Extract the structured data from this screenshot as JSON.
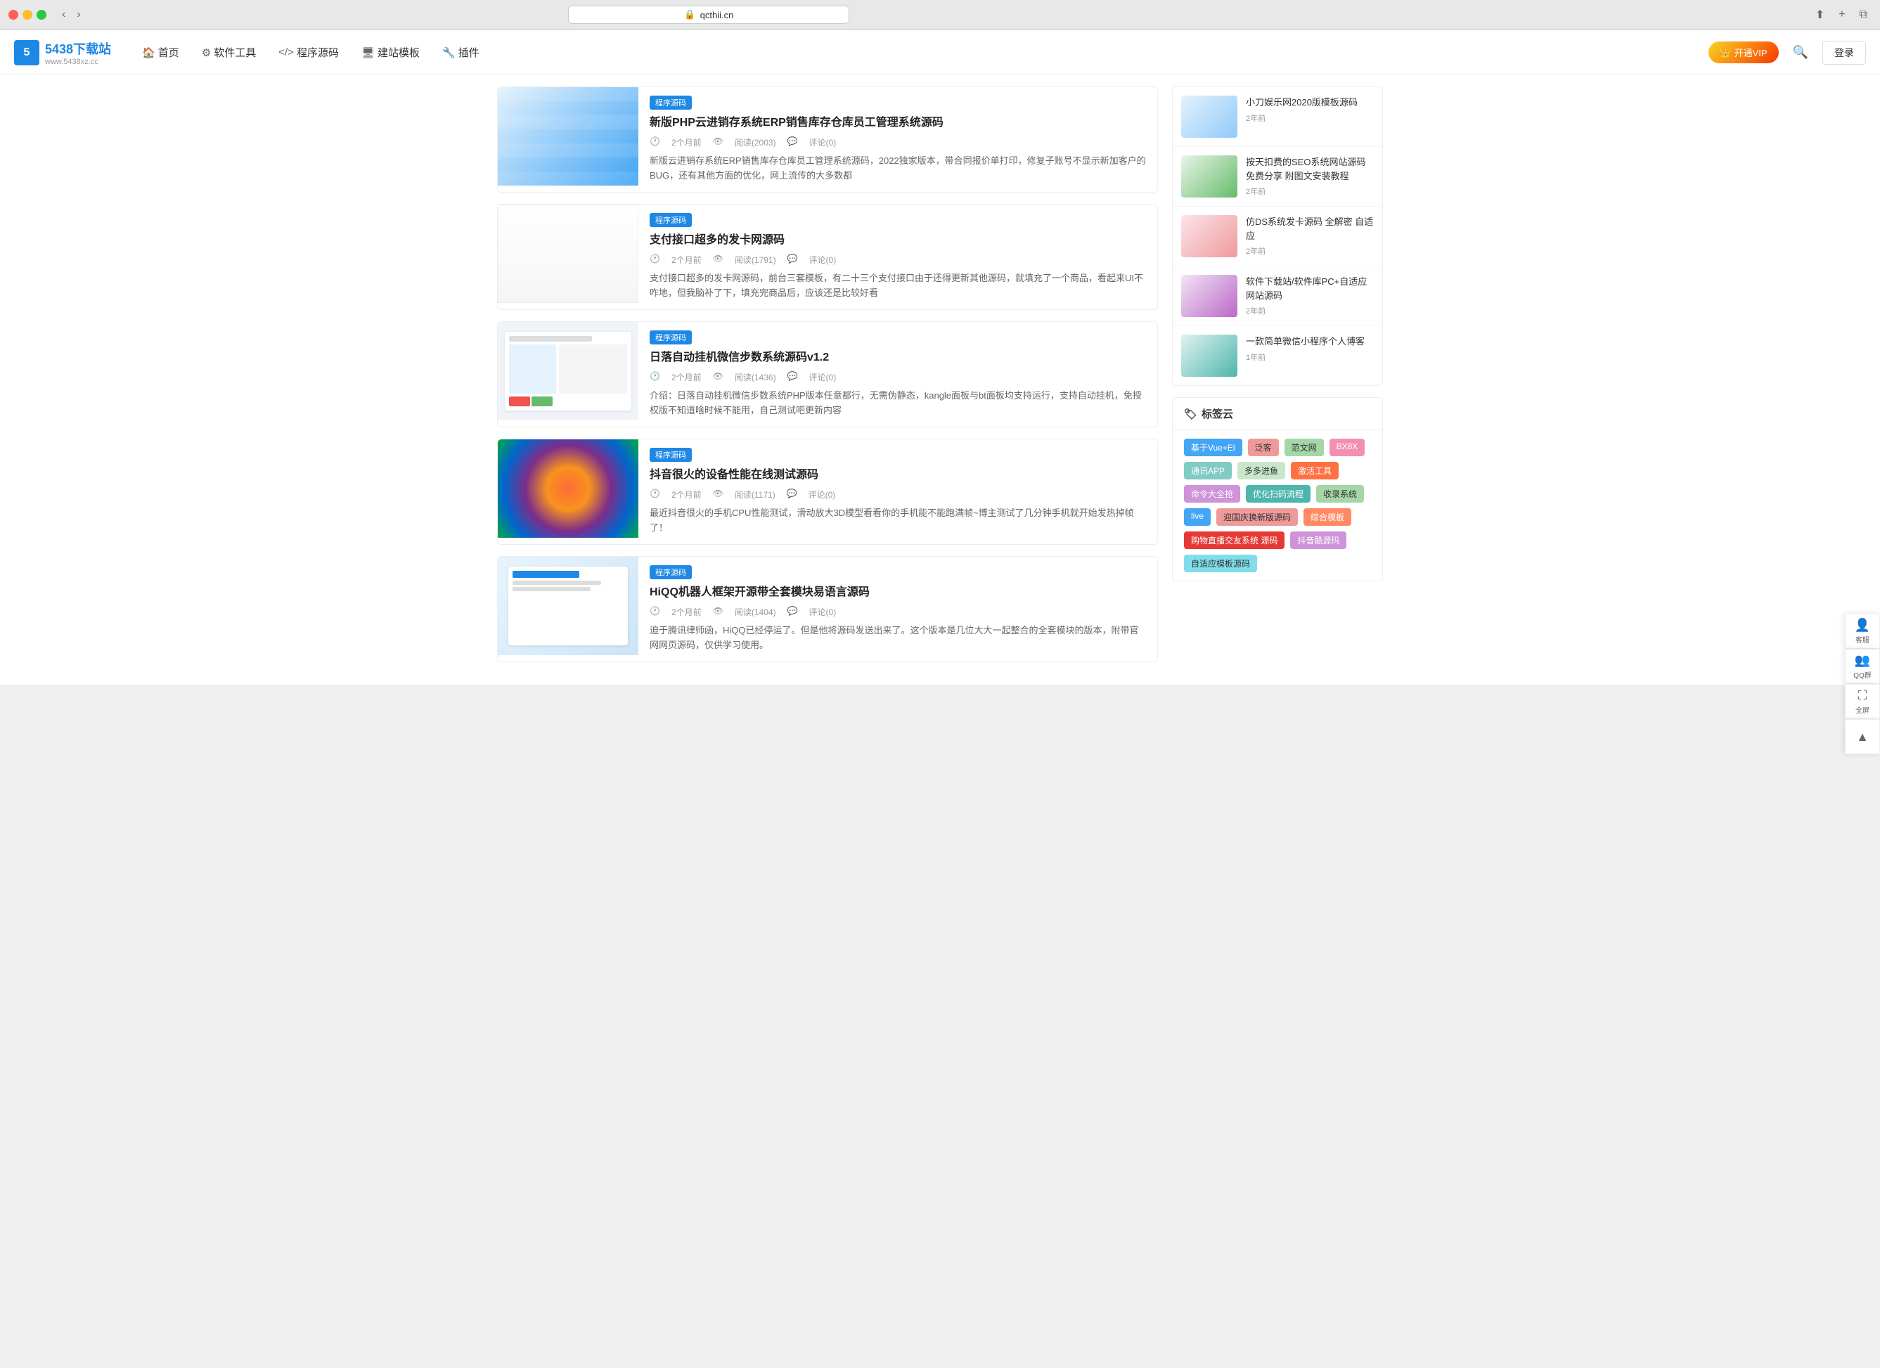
{
  "browser": {
    "url": "qcthii.cn",
    "back_btn": "←",
    "forward_btn": "→"
  },
  "header": {
    "logo_number": "5438",
    "logo_text": "下载站",
    "logo_subtitle": "www.5438xz.cc",
    "logo_short": "5",
    "nav": [
      {
        "label": "首页",
        "icon": "🏠"
      },
      {
        "label": "软件工具",
        "icon": "⚙️"
      },
      {
        "label": "程序源码",
        "icon": "<>"
      },
      {
        "label": "建站模板",
        "icon": "🖥️"
      },
      {
        "label": "插件",
        "icon": "🔧"
      }
    ],
    "vip_label": "开通VIP",
    "login_label": "登录",
    "search_placeholder": "搜索"
  },
  "articles": [
    {
      "tag": "程序源码",
      "title": "新版PHP云进销存系统ERP销售库存仓库员工管理系统源码",
      "time": "2个月前",
      "reads": "阅读(2003)",
      "comments": "评论(0)",
      "desc": "新版云进销存系统ERP销售库存仓库员工管理系统源码，2022独家版本，带合同报价单打印，修复子账号不显示新加客户的BUG，还有其他方面的优化，网上流传的大多数都",
      "thumb_class": "thumb-1"
    },
    {
      "tag": "程序源码",
      "title": "支付接口超多的发卡网源码",
      "time": "2个月前",
      "reads": "阅读(1791)",
      "comments": "评论(0)",
      "desc": "支付接口超多的发卡网源码，前台三套模板，有二十三个支付接口由于还得更新其他源码，就填充了一个商品，看起来UI不咋地，但我脑补了下，填充完商品后，应该还是比较好看",
      "thumb_class": "thumb-2"
    },
    {
      "tag": "程序源码",
      "title": "日落自动挂机微信步数系统源码v1.2",
      "time": "2个月前",
      "reads": "阅读(1436)",
      "comments": "评论(0)",
      "desc": "介绍：日落自动挂机微信步数系统PHP版本任意都行，无需伪静态，kangle面板与bt面板均支持运行，支持自动挂机，免授权版不知道啥时候不能用，自己测试吧更新内容",
      "thumb_class": "thumb-3"
    },
    {
      "tag": "程序源码",
      "title": "抖音很火的设备性能在线测试源码",
      "time": "2个月前",
      "reads": "阅读(1171)",
      "comments": "评论(0)",
      "desc": "最近抖音很火的手机CPU性能测试，滑动放大3D模型看看你的手机能不能跑满帧~博主测试了几分钟手机就开始发热掉帧了！",
      "thumb_class": "thumb-4"
    },
    {
      "tag": "程序源码",
      "title": "HiQQ机器人框架开源带全套模块易语言源码",
      "time": "2个月前",
      "reads": "阅读(1404)",
      "comments": "评论(0)",
      "desc": "迫于腾讯律师函，HiQQ已经停运了。但是他将源码发送出来了。这个版本是几位大大一起整合的全套模块的版本，附带官网网页源码，仅供学习使用。",
      "thumb_class": "thumb-5"
    }
  ],
  "sidebar_articles": [
    {
      "title": "小刀娱乐网2020版模板源码",
      "time": "2年前",
      "thumb_class": "sidebar-thumb-1"
    },
    {
      "title": "按天扣费的SEO系统网站源码 免费分享 附图文安装教程",
      "time": "2年前",
      "thumb_class": "sidebar-thumb-2"
    },
    {
      "title": "仿DS系统发卡源码 全解密 自适应",
      "time": "2年前",
      "thumb_class": "sidebar-thumb-3"
    },
    {
      "title": "软件下载站/软件库PC+自适应网站源码",
      "time": "2年前",
      "thumb_class": "sidebar-thumb-4"
    },
    {
      "title": "一款简单微信小程序个人博客",
      "time": "1年前",
      "thumb_class": "sidebar-thumb-5"
    }
  ],
  "tag_cloud": {
    "header": "标签云",
    "tags": [
      {
        "label": "基于Vue+El",
        "color": "#42a5f5"
      },
      {
        "label": "泛客",
        "color": "#ef9a9a"
      },
      {
        "label": "范文网",
        "color": "#a5d6a7"
      },
      {
        "label": "BX8X",
        "color": "#f48fb1"
      },
      {
        "label": "通讯APP",
        "color": "#80cbc4"
      },
      {
        "label": "多多进鱼",
        "color": "#e6ee9c"
      },
      {
        "label": "激活工具",
        "color": "#ff7043"
      },
      {
        "label": "命令大全抢",
        "color": "#ce93d8"
      },
      {
        "label": "优化扫码流程",
        "color": "#4db6ac"
      },
      {
        "label": "收录系统",
        "color": "#a5d6a7"
      },
      {
        "label": "live",
        "color": "#42a5f5"
      },
      {
        "label": "迎国庆换新版源码",
        "color": "#ef9a9a"
      },
      {
        "label": "综合模板",
        "color": "#ff8a65"
      },
      {
        "label": "购物直播交友系统 源码",
        "color": "#e53935"
      },
      {
        "label": "抖音酷源码",
        "color": "#ce93d8"
      },
      {
        "label": "自适应模板源码",
        "color": "#80deea"
      }
    ]
  },
  "floating_btns": [
    {
      "label": "客服",
      "icon": "👤"
    },
    {
      "label": "QQ群",
      "icon": "👥"
    },
    {
      "label": "全屏",
      "icon": "⛶"
    },
    {
      "label": "",
      "icon": "▲"
    }
  ]
}
